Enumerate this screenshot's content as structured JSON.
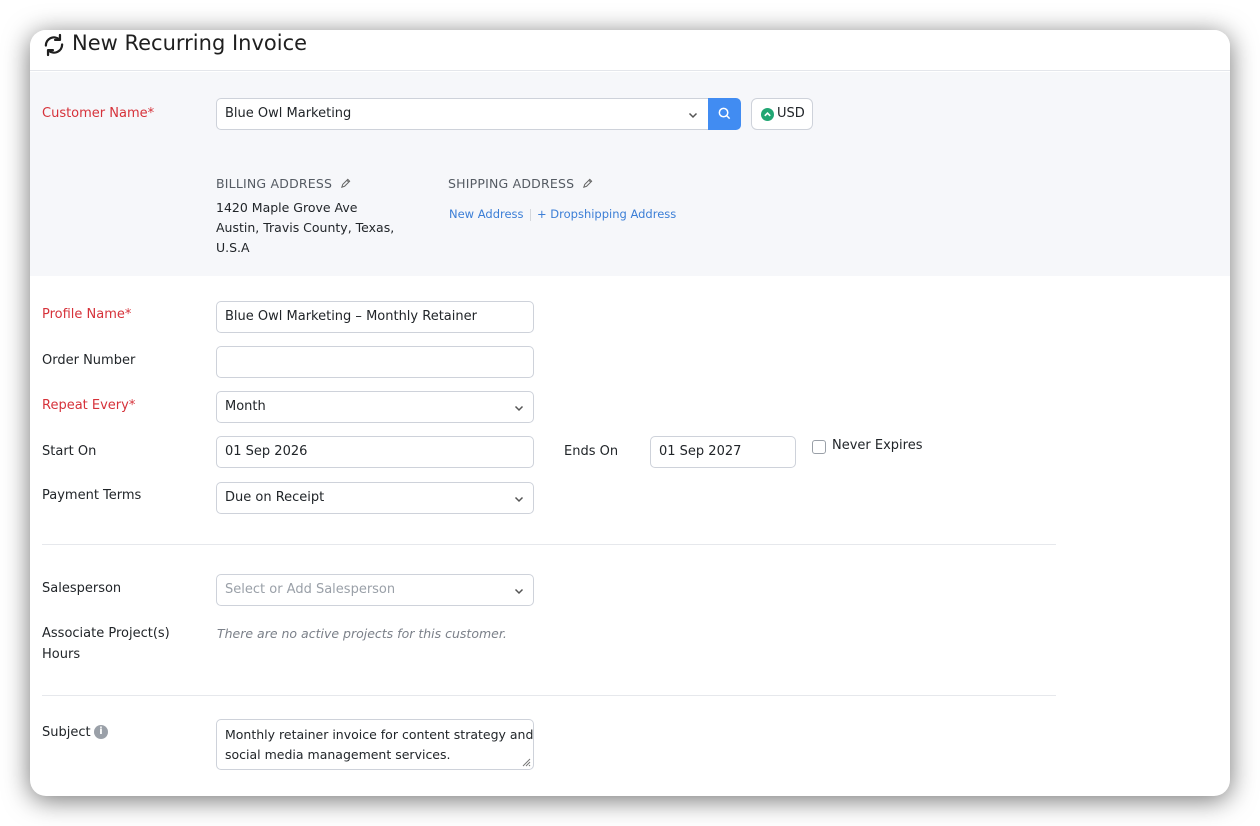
{
  "header": {
    "title": "New Recurring Invoice"
  },
  "customer": {
    "label": "Customer Name*",
    "value": "Blue Owl Marketing",
    "currency": "USD",
    "billing": {
      "heading": "BILLING ADDRESS",
      "lines": [
        "1420 Maple Grove Ave",
        "Austin, Travis County, Texas,",
        "U.S.A"
      ]
    },
    "shipping": {
      "heading": "SHIPPING ADDRESS",
      "new_address": "New Address",
      "dropshipping": "+ Dropshipping Address"
    }
  },
  "form": {
    "profile_name": {
      "label": "Profile Name*",
      "value": "Blue Owl Marketing – Monthly Retainer"
    },
    "order_number": {
      "label": "Order Number",
      "value": ""
    },
    "repeat_every": {
      "label": "Repeat Every*",
      "value": "Month"
    },
    "start_on": {
      "label": "Start On",
      "value": "01 Sep 2026"
    },
    "ends_on": {
      "label": "Ends On",
      "value": "01 Sep 2027"
    },
    "never_expires": {
      "label": "Never Expires",
      "checked": false
    },
    "payment_terms": {
      "label": "Payment Terms",
      "value": "Due on Receipt"
    },
    "salesperson": {
      "label": "Salesperson",
      "placeholder": "Select or Add Salesperson"
    },
    "projects": {
      "label_line1": "Associate Project(s)",
      "label_line2": "Hours",
      "note": "There are no active projects for this customer."
    },
    "subject": {
      "label": "Subject",
      "value_line1": "Monthly retainer invoice for content strategy and",
      "value_line2": "social media management services."
    }
  },
  "colors": {
    "accent": "#418cf2",
    "required": "#d6323a",
    "link": "#3b7ed6",
    "currency_dot": "#21a673"
  }
}
